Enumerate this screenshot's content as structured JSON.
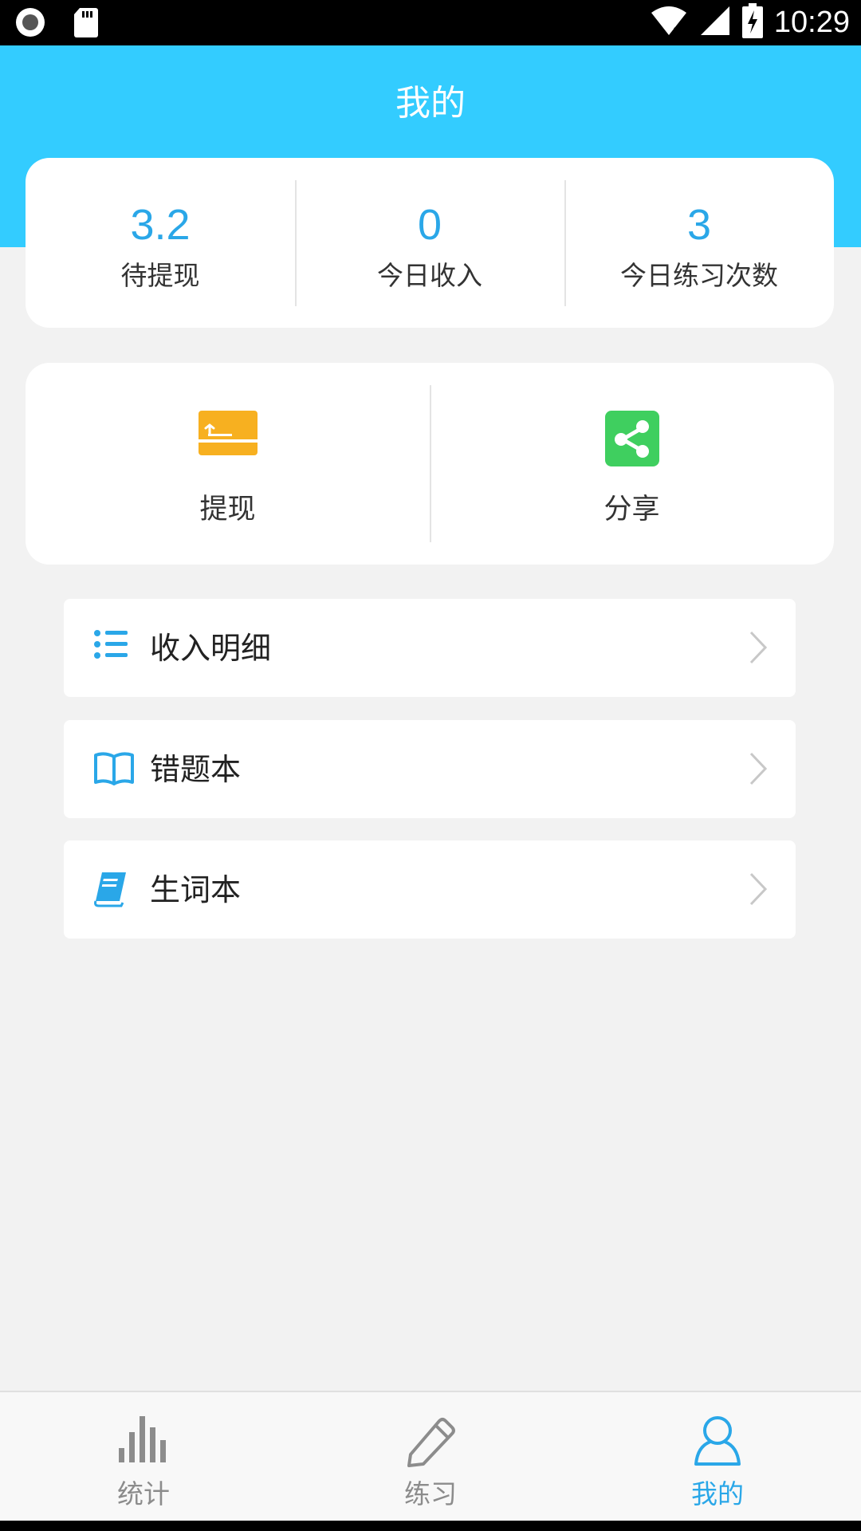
{
  "status_bar": {
    "time": "10:29"
  },
  "header": {
    "title": "我的"
  },
  "stats": [
    {
      "value": "3.2",
      "label": "待提现"
    },
    {
      "value": "0",
      "label": "今日收入"
    },
    {
      "value": "3",
      "label": "今日练习次数"
    }
  ],
  "actions": [
    {
      "label": "提现",
      "icon": "withdraw-icon",
      "color": "#f7b020"
    },
    {
      "label": "分享",
      "icon": "share-icon",
      "color": "#3fcf5f"
    }
  ],
  "menu": [
    {
      "label": "收入明细",
      "icon": "list-icon"
    },
    {
      "label": "错题本",
      "icon": "open-book-icon"
    },
    {
      "label": "生词本",
      "icon": "notebook-icon"
    }
  ],
  "bottom_nav": [
    {
      "label": "统计",
      "icon": "bar-chart-icon",
      "active": false
    },
    {
      "label": "练习",
      "icon": "pencil-icon",
      "active": false
    },
    {
      "label": "我的",
      "icon": "user-icon",
      "active": true
    }
  ],
  "colors": {
    "header": "#33ccff",
    "accent": "#2aa7e8"
  }
}
